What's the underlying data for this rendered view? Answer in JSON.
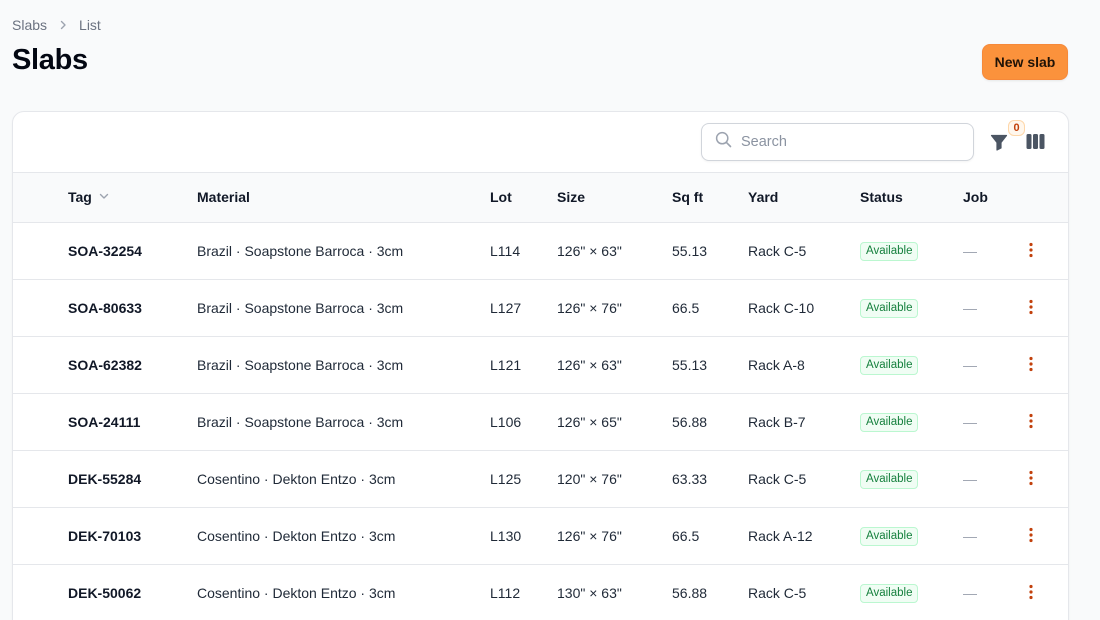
{
  "breadcrumb": {
    "root": "Slabs",
    "current": "List"
  },
  "page": {
    "title": "Slabs",
    "new_button": "New slab"
  },
  "colors": {
    "accent": "#fb923c",
    "available_text": "#15803d",
    "available_bg": "#f0fdf4",
    "action_icon": "#c2410c"
  },
  "toolbar": {
    "search_placeholder": "Search",
    "filter_count": "0",
    "filter_icon": "funnel-icon",
    "columns_icon": "columns-icon"
  },
  "table": {
    "columns": {
      "tag": "Tag",
      "material": "Material",
      "lot": "Lot",
      "size": "Size",
      "sqft": "Sq ft",
      "yard": "Yard",
      "status": "Status",
      "job": "Job"
    },
    "rows": [
      {
        "tag": "SOA-32254",
        "material": "Brazil · Soapstone Barroca · 3cm",
        "lot": "L114",
        "size": "126\" × 63\"",
        "sqft": "55.13",
        "yard": "Rack C-5",
        "status": "Available",
        "job": "—"
      },
      {
        "tag": "SOA-80633",
        "material": "Brazil · Soapstone Barroca · 3cm",
        "lot": "L127",
        "size": "126\" × 76\"",
        "sqft": "66.5",
        "yard": "Rack C-10",
        "status": "Available",
        "job": "—"
      },
      {
        "tag": "SOA-62382",
        "material": "Brazil · Soapstone Barroca · 3cm",
        "lot": "L121",
        "size": "126\" × 63\"",
        "sqft": "55.13",
        "yard": "Rack A-8",
        "status": "Available",
        "job": "—"
      },
      {
        "tag": "SOA-24111",
        "material": "Brazil · Soapstone Barroca · 3cm",
        "lot": "L106",
        "size": "126\" × 65\"",
        "sqft": "56.88",
        "yard": "Rack B-7",
        "status": "Available",
        "job": "—"
      },
      {
        "tag": "DEK-55284",
        "material": "Cosentino · Dekton Entzo · 3cm",
        "lot": "L125",
        "size": "120\" × 76\"",
        "sqft": "63.33",
        "yard": "Rack C-5",
        "status": "Available",
        "job": "—"
      },
      {
        "tag": "DEK-70103",
        "material": "Cosentino · Dekton Entzo · 3cm",
        "lot": "L130",
        "size": "126\" × 76\"",
        "sqft": "66.5",
        "yard": "Rack A-12",
        "status": "Available",
        "job": "—"
      },
      {
        "tag": "DEK-50062",
        "material": "Cosentino · Dekton Entzo · 3cm",
        "lot": "L112",
        "size": "130\" × 63\"",
        "sqft": "56.88",
        "yard": "Rack C-5",
        "status": "Available",
        "job": "—"
      }
    ]
  }
}
